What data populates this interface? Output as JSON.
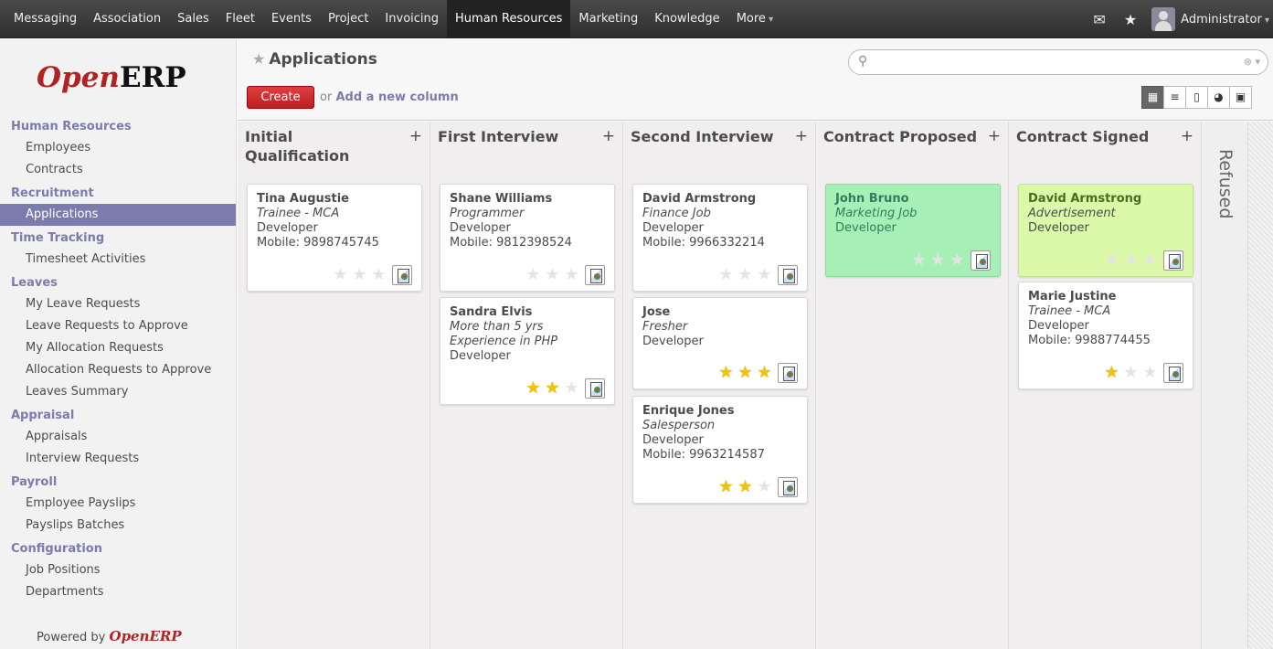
{
  "topmenu": {
    "items": [
      "Messaging",
      "Association",
      "Sales",
      "Fleet",
      "Events",
      "Project",
      "Invoicing",
      "Human Resources",
      "Marketing",
      "Knowledge",
      "More"
    ],
    "active": "Human Resources"
  },
  "user": {
    "name": "Administrator"
  },
  "logo": {
    "open": "Open",
    "erp": "ERP"
  },
  "sidebar": {
    "sections": [
      {
        "title": "Human Resources",
        "items": [
          "Employees",
          "Contracts"
        ]
      },
      {
        "title": "Recruitment",
        "items": [
          "Applications"
        ]
      },
      {
        "title": "Time Tracking",
        "items": [
          "Timesheet Activities"
        ]
      },
      {
        "title": "Leaves",
        "items": [
          "My Leave Requests",
          "Leave Requests to Approve",
          "My Allocation Requests",
          "Allocation Requests to Approve",
          "Leaves Summary"
        ]
      },
      {
        "title": "Appraisal",
        "items": [
          "Appraisals",
          "Interview Requests"
        ]
      },
      {
        "title": "Payroll",
        "items": [
          "Employee Payslips",
          "Payslips Batches"
        ]
      },
      {
        "title": "Configuration",
        "items": [
          "Job Positions",
          "Departments"
        ]
      }
    ],
    "active_item": "Applications",
    "powered_prefix": "Powered by",
    "powered_brand": "OpenERP"
  },
  "header": {
    "title": "Applications",
    "create_label": "Create",
    "or_text": "or",
    "add_column_label": "Add a new column",
    "search_placeholder": ""
  },
  "columns": [
    {
      "title": "Initial Qualification",
      "cards": [
        {
          "name": "Tina Augustie",
          "job": "Trainee - MCA",
          "department": "Developer",
          "mobile": "Mobile: 9898745745",
          "stars": 0,
          "color": "white"
        }
      ]
    },
    {
      "title": "First Interview",
      "cards": [
        {
          "name": "Shane Williams",
          "job": "Programmer",
          "department": "Developer",
          "mobile": "Mobile: 9812398524",
          "stars": 0,
          "color": "white"
        },
        {
          "name": "Sandra Elvis",
          "job": "More than 5 yrs Experience in PHP",
          "department": "Developer",
          "mobile": "",
          "stars": 2,
          "color": "white"
        }
      ]
    },
    {
      "title": "Second Interview",
      "cards": [
        {
          "name": "David Armstrong",
          "job": "Finance Job",
          "department": "Developer",
          "mobile": "Mobile: 9966332214",
          "stars": 0,
          "color": "white"
        },
        {
          "name": "Jose",
          "job": "Fresher",
          "department": "Developer",
          "mobile": "",
          "stars": 3,
          "color": "white"
        },
        {
          "name": "Enrique Jones",
          "job": "Salesperson",
          "department": "Developer",
          "mobile": "Mobile: 9963214587",
          "stars": 2,
          "color": "white"
        }
      ]
    },
    {
      "title": "Contract Proposed",
      "cards": [
        {
          "name": "John Bruno",
          "job": "Marketing Job",
          "department": "Developer",
          "mobile": "",
          "stars": 0,
          "color": "green"
        }
      ]
    },
    {
      "title": "Contract Signed",
      "cards": [
        {
          "name": "David Armstrong",
          "job": "Advertisement",
          "department": "Developer",
          "mobile": "",
          "stars": 0,
          "color": "lime"
        },
        {
          "name": "Marie Justine",
          "job": "Trainee - MCA",
          "department": "Developer",
          "mobile": "Mobile: 9988774455",
          "stars": 1,
          "color": "white"
        }
      ]
    }
  ],
  "refused": {
    "title": "Refused"
  },
  "icons": {
    "mail": "envelope-icon",
    "star": "star-icon",
    "search": "search-icon",
    "clear": "clear-icon"
  },
  "colors": {
    "accent": "#7c7bad",
    "create": "#c52a2a",
    "green_card": "#a6f0b8",
    "lime_card": "#dbf9a8",
    "star_on": "#f0c400"
  }
}
